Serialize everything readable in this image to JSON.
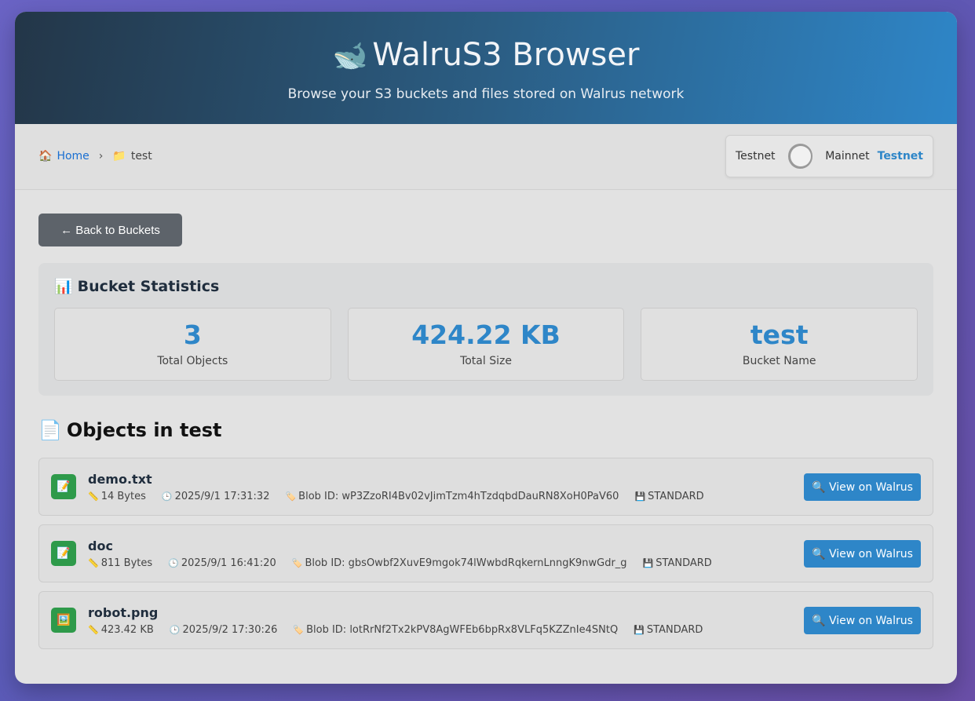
{
  "header": {
    "title": "WalruS3 Browser",
    "subtitle": "Browse your S3 buckets and files stored on Walrus network"
  },
  "breadcrumb": {
    "home_label": "Home",
    "separator": "›",
    "current": "test"
  },
  "network": {
    "left_label": "Testnet",
    "right_label": "Mainnet",
    "current": "Testnet"
  },
  "back_button": "← Back to Buckets",
  "stats": {
    "title": "Bucket Statistics",
    "items": [
      {
        "value": "3",
        "label": "Total Objects"
      },
      {
        "value": "424.22 KB",
        "label": "Total Size"
      },
      {
        "value": "test",
        "label": "Bucket Name"
      }
    ]
  },
  "objects": {
    "title": "Objects in test",
    "view_label": "🔍 View on Walrus",
    "items": [
      {
        "name": "demo.txt",
        "size": "14 Bytes",
        "date": "2025/9/1 17:31:32",
        "blob": "Blob ID: wP3ZzoRI4Bv02vJimTzm4hTzdqbdDauRN8XoH0PaV60",
        "storage": "STANDARD",
        "icon": "document-icon"
      },
      {
        "name": "doc",
        "size": "811 Bytes",
        "date": "2025/9/1 16:41:20",
        "blob": "Blob ID: gbsOwbf2XuvE9mgok74lWwbdRqkernLnngK9nwGdr_g",
        "storage": "STANDARD",
        "icon": "document-icon"
      },
      {
        "name": "robot.png",
        "size": "423.42 KB",
        "date": "2025/9/2 17:30:26",
        "blob": "Blob ID: lotRrNf2Tx2kPV8AgWFEb6bpRx8VLFq5KZZnIe4SNtQ",
        "storage": "STANDARD",
        "icon": "image-icon"
      }
    ]
  },
  "colors": {
    "accent": "#2e86c8",
    "file_icon_bg": "#2e9a4a",
    "back_button_bg": "#5d636a"
  }
}
